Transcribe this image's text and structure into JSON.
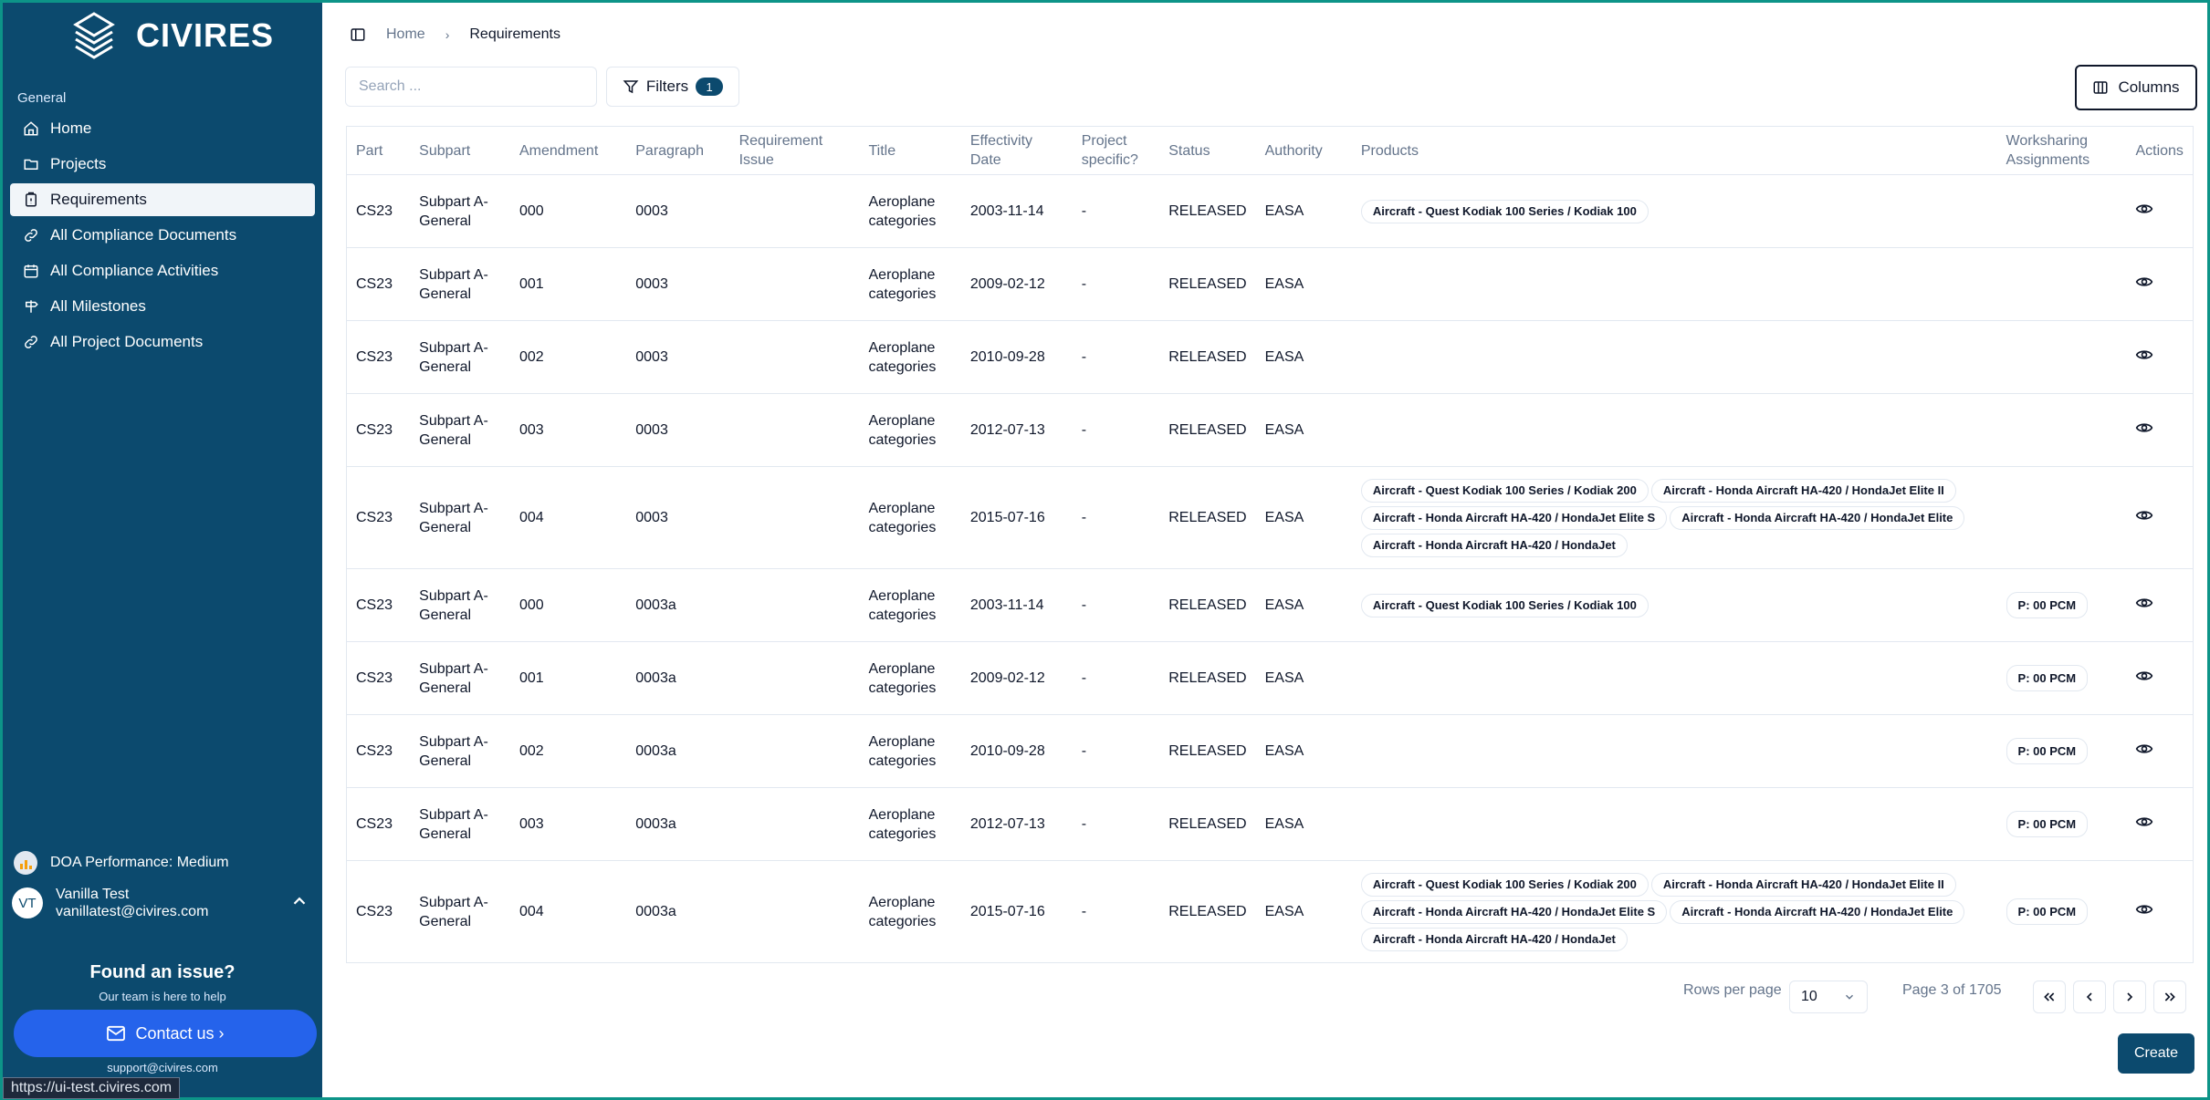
{
  "app": {
    "name": "CIVIRES"
  },
  "sidebar": {
    "section_label": "General",
    "items": [
      {
        "label": "Home",
        "icon": "home-icon"
      },
      {
        "label": "Projects",
        "icon": "folder-icon"
      },
      {
        "label": "Requirements",
        "icon": "clipboard-icon"
      },
      {
        "label": "All Compliance Documents",
        "icon": "link-icon"
      },
      {
        "label": "All Compliance Activities",
        "icon": "calendar-icon"
      },
      {
        "label": "All Milestones",
        "icon": "signpost-icon"
      },
      {
        "label": "All Project Documents",
        "icon": "link-icon"
      }
    ],
    "performance": "DOA Performance: Medium",
    "user": {
      "initials": "VT",
      "name": "Vanilla Test",
      "email": "vanillatest@civires.com"
    },
    "help": {
      "title": "Found an issue?",
      "subtitle": "Our team is here to help",
      "contact_label": "Contact us ›",
      "support_email": "support@civires.com"
    }
  },
  "status_url": "https://ui-test.civires.com",
  "breadcrumb": {
    "home": "Home",
    "current": "Requirements"
  },
  "toolbar": {
    "search_placeholder": "Search ...",
    "filters_label": "Filters",
    "filters_count": "1",
    "columns_label": "Columns"
  },
  "table": {
    "headers": {
      "part": "Part",
      "subpart": "Subpart",
      "amendment": "Amendment",
      "paragraph": "Paragraph",
      "requirement_issue": "Requirement Issue",
      "title": "Title",
      "effectivity_date": "Effectivity Date",
      "project_specific": "Project specific?",
      "status": "Status",
      "authority": "Authority",
      "products": "Products",
      "worksharing": "Worksharing Assignments",
      "actions": "Actions"
    },
    "rows": [
      {
        "part": "CS23",
        "subpart": "Subpart A- General",
        "amendment": "000",
        "paragraph": "0003",
        "issue": "",
        "title": "Aeroplane categories",
        "date": "2003-11-14",
        "specific": "-",
        "status": "RELEASED",
        "authority": "EASA",
        "products": [
          "Aircraft - Quest Kodiak 100 Series / Kodiak 100"
        ],
        "ws": ""
      },
      {
        "part": "CS23",
        "subpart": "Subpart A- General",
        "amendment": "001",
        "paragraph": "0003",
        "issue": "",
        "title": "Aeroplane categories",
        "date": "2009-02-12",
        "specific": "-",
        "status": "RELEASED",
        "authority": "EASA",
        "products": [],
        "ws": ""
      },
      {
        "part": "CS23",
        "subpart": "Subpart A- General",
        "amendment": "002",
        "paragraph": "0003",
        "issue": "",
        "title": "Aeroplane categories",
        "date": "2010-09-28",
        "specific": "-",
        "status": "RELEASED",
        "authority": "EASA",
        "products": [],
        "ws": ""
      },
      {
        "part": "CS23",
        "subpart": "Subpart A- General",
        "amendment": "003",
        "paragraph": "0003",
        "issue": "",
        "title": "Aeroplane categories",
        "date": "2012-07-13",
        "specific": "-",
        "status": "RELEASED",
        "authority": "EASA",
        "products": [],
        "ws": ""
      },
      {
        "part": "CS23",
        "subpart": "Subpart A- General",
        "amendment": "004",
        "paragraph": "0003",
        "issue": "",
        "title": "Aeroplane categories",
        "date": "2015-07-16",
        "specific": "-",
        "status": "RELEASED",
        "authority": "EASA",
        "products": [
          "Aircraft - Quest Kodiak 100 Series / Kodiak 200",
          "Aircraft - Honda Aircraft HA-420 / HondaJet Elite II",
          "Aircraft - Honda Aircraft HA-420 / HondaJet Elite S",
          "Aircraft - Honda Aircraft HA-420 / HondaJet Elite",
          "Aircraft - Honda Aircraft HA-420 / HondaJet"
        ],
        "ws": ""
      },
      {
        "part": "CS23",
        "subpart": "Subpart A- General",
        "amendment": "000",
        "paragraph": "0003a",
        "issue": "",
        "title": "Aeroplane categories",
        "date": "2003-11-14",
        "specific": "-",
        "status": "RELEASED",
        "authority": "EASA",
        "products": [
          "Aircraft - Quest Kodiak 100 Series / Kodiak 100"
        ],
        "ws": "P: 00 PCM"
      },
      {
        "part": "CS23",
        "subpart": "Subpart A- General",
        "amendment": "001",
        "paragraph": "0003a",
        "issue": "",
        "title": "Aeroplane categories",
        "date": "2009-02-12",
        "specific": "-",
        "status": "RELEASED",
        "authority": "EASA",
        "products": [],
        "ws": "P: 00 PCM"
      },
      {
        "part": "CS23",
        "subpart": "Subpart A- General",
        "amendment": "002",
        "paragraph": "0003a",
        "issue": "",
        "title": "Aeroplane categories",
        "date": "2010-09-28",
        "specific": "-",
        "status": "RELEASED",
        "authority": "EASA",
        "products": [],
        "ws": "P: 00 PCM"
      },
      {
        "part": "CS23",
        "subpart": "Subpart A- General",
        "amendment": "003",
        "paragraph": "0003a",
        "issue": "",
        "title": "Aeroplane categories",
        "date": "2012-07-13",
        "specific": "-",
        "status": "RELEASED",
        "authority": "EASA",
        "products": [],
        "ws": "P: 00 PCM"
      },
      {
        "part": "CS23",
        "subpart": "Subpart A- General",
        "amendment": "004",
        "paragraph": "0003a",
        "issue": "",
        "title": "Aeroplane categories",
        "date": "2015-07-16",
        "specific": "-",
        "status": "RELEASED",
        "authority": "EASA",
        "products": [
          "Aircraft - Quest Kodiak 100 Series / Kodiak 200",
          "Aircraft - Honda Aircraft HA-420 / HondaJet Elite II",
          "Aircraft - Honda Aircraft HA-420 / HondaJet Elite S",
          "Aircraft - Honda Aircraft HA-420 / HondaJet Elite",
          "Aircraft - Honda Aircraft HA-420 / HondaJet"
        ],
        "ws": "P: 00 PCM"
      }
    ]
  },
  "pagination": {
    "rows_per_page_label": "Rows per page",
    "rows_per_page_value": "10",
    "page_info": "Page 3 of 1705"
  },
  "create_label": "Create",
  "colors": {
    "sidebar_bg": "#0c4a6e",
    "accent": "#2563eb",
    "border": "#e2e8f0"
  }
}
